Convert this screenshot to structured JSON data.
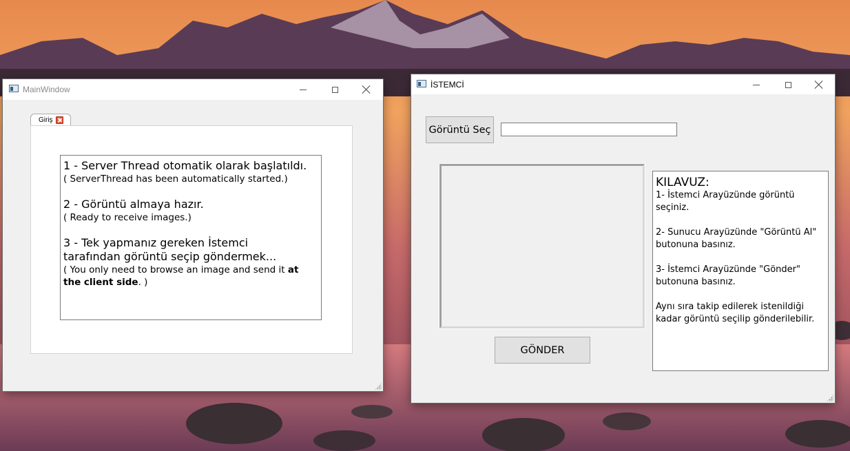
{
  "main_window": {
    "title": "MainWindow",
    "tab_label": "Giriş",
    "info": {
      "line1": "1 - Server Thread otomatik olarak başlatıldı.",
      "line1_en": "( ServerThread has been automatically started.)",
      "line2": "2 - Görüntü almaya hazır.",
      "line2_en": "( Ready to receive images.)",
      "line3a": "3 - Tek yapmanız gereken İstemci",
      "line3b": "tarafından görüntü seçip göndermek...",
      "line3_en_a": "( You only need to browse an image and send it ",
      "line3_en_bold": "at the client side",
      "line3_en_end": ". )"
    }
  },
  "client_window": {
    "title": "İSTEMCİ",
    "browse_label": "Görüntü Seç",
    "path_value": "",
    "send_label": "GÖNDER",
    "guide": {
      "title": "KILAVUZ:",
      "step1": "1- İstemci Arayüzünde görüntü seçiniz.",
      "step2": "2-  Sunucu Arayüzünde \"Görüntü Al\" butonuna basınız.",
      "step3": "3- İstemci Arayüzünde \"Gönder\" butonuna basınız.",
      "note": "Aynı sıra takip edilerek istenildiği kadar görüntü seçilip gönderilebilir."
    }
  },
  "colors": {
    "window_bg": "#f0f0f0",
    "tab_close": "#e0553b",
    "button_bg": "#e1e1e1"
  }
}
